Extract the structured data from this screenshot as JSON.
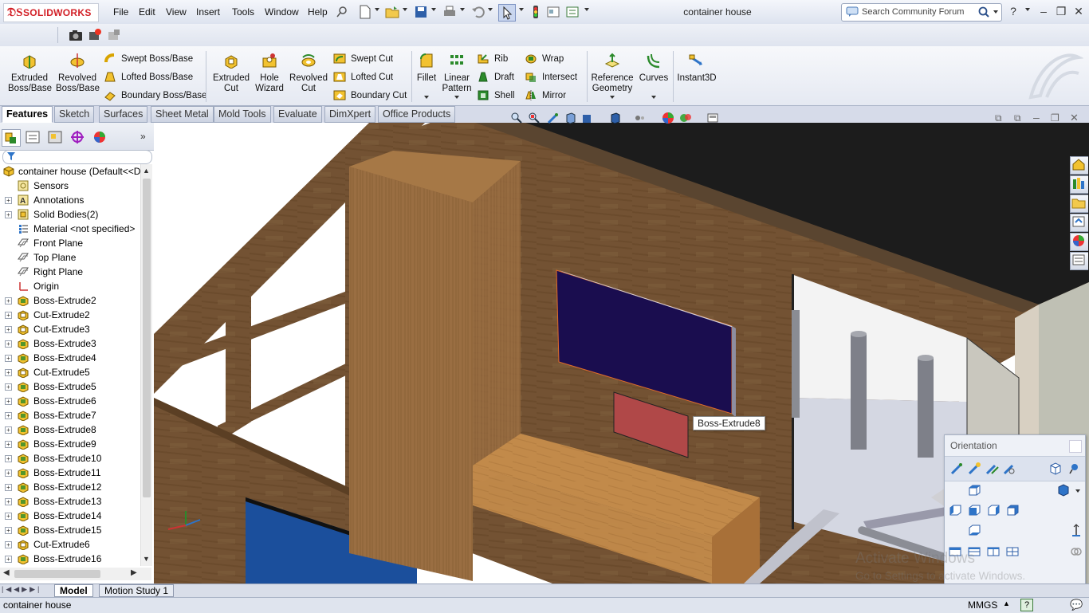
{
  "app": {
    "logo_text": "SOLIDWORKS",
    "document_title": "container house"
  },
  "menu": [
    "File",
    "Edit",
    "View",
    "Insert",
    "Tools",
    "Window",
    "Help"
  ],
  "search": {
    "placeholder": "Search Community Forum"
  },
  "window_controls": {
    "help": "?",
    "minimize": "–",
    "restore": "❐",
    "close": "✕"
  },
  "command_manager": {
    "extruded_boss": "Extruded Boss/Base",
    "revolved_boss": "Revolved Boss/Base",
    "swept_boss": "Swept Boss/Base",
    "lofted_boss": "Lofted Boss/Base",
    "boundary_boss": "Boundary Boss/Base",
    "extruded_cut": "Extruded Cut",
    "hole_wizard": "Hole Wizard",
    "revolved_cut": "Revolved Cut",
    "swept_cut": "Swept Cut",
    "lofted_cut": "Lofted Cut",
    "boundary_cut": "Boundary Cut",
    "fillet": "Fillet",
    "linear_pattern": "Linear Pattern",
    "rib": "Rib",
    "draft": "Draft",
    "shell": "Shell",
    "wrap": "Wrap",
    "intersect": "Intersect",
    "mirror": "Mirror",
    "reference_geometry": "Reference Geometry",
    "curves": "Curves",
    "instant3d": "Instant3D"
  },
  "tabs": [
    "Features",
    "Sketch",
    "Surfaces",
    "Sheet Metal",
    "Mold Tools",
    "Evaluate",
    "DimXpert",
    "Office Products"
  ],
  "active_tab": "Features",
  "feature_tree": {
    "root": "container house  (Default<<D",
    "items": [
      {
        "label": "Sensors",
        "icon": "sensor-icon",
        "expand": false
      },
      {
        "label": "Annotations",
        "icon": "annotations-icon",
        "expand": true
      },
      {
        "label": "Solid Bodies(2)",
        "icon": "solid-bodies-icon",
        "expand": true
      },
      {
        "label": "Material <not specified>",
        "icon": "material-icon",
        "expand": false
      },
      {
        "label": "Front Plane",
        "icon": "plane-icon",
        "expand": false
      },
      {
        "label": "Top Plane",
        "icon": "plane-icon",
        "expand": false
      },
      {
        "label": "Right Plane",
        "icon": "plane-icon",
        "expand": false
      },
      {
        "label": "Origin",
        "icon": "origin-icon",
        "expand": false
      },
      {
        "label": "Boss-Extrude2",
        "icon": "boss-extrude-icon",
        "expand": true
      },
      {
        "label": "Cut-Extrude2",
        "icon": "cut-extrude-icon",
        "expand": true
      },
      {
        "label": "Cut-Extrude3",
        "icon": "cut-extrude-icon",
        "expand": true
      },
      {
        "label": "Boss-Extrude3",
        "icon": "boss-extrude-icon",
        "expand": true
      },
      {
        "label": "Boss-Extrude4",
        "icon": "boss-extrude-icon",
        "expand": true
      },
      {
        "label": "Cut-Extrude5",
        "icon": "cut-extrude-icon",
        "expand": true
      },
      {
        "label": "Boss-Extrude5",
        "icon": "boss-extrude-icon",
        "expand": true
      },
      {
        "label": "Boss-Extrude6",
        "icon": "boss-extrude-icon",
        "expand": true
      },
      {
        "label": "Boss-Extrude7",
        "icon": "boss-extrude-icon",
        "expand": true
      },
      {
        "label": "Boss-Extrude8",
        "icon": "boss-extrude-icon",
        "expand": true
      },
      {
        "label": "Boss-Extrude9",
        "icon": "boss-extrude-icon",
        "expand": true
      },
      {
        "label": "Boss-Extrude10",
        "icon": "boss-extrude-icon",
        "expand": true
      },
      {
        "label": "Boss-Extrude11",
        "icon": "boss-extrude-icon",
        "expand": true
      },
      {
        "label": "Boss-Extrude12",
        "icon": "boss-extrude-icon",
        "expand": true
      },
      {
        "label": "Boss-Extrude13",
        "icon": "boss-extrude-icon",
        "expand": true
      },
      {
        "label": "Boss-Extrude14",
        "icon": "boss-extrude-icon",
        "expand": true
      },
      {
        "label": "Boss-Extrude15",
        "icon": "boss-extrude-icon",
        "expand": true
      },
      {
        "label": "Cut-Extrude6",
        "icon": "cut-extrude-icon",
        "expand": true
      },
      {
        "label": "Boss-Extrude16",
        "icon": "boss-extrude-icon",
        "expand": true
      }
    ]
  },
  "bottom_tabs": [
    "Model",
    "Motion Study 1"
  ],
  "status": {
    "left": "container house",
    "units": "MMGS"
  },
  "tooltip": "Boss-Extrude8",
  "orientation_panel": {
    "title": "Orientation"
  },
  "watermark": {
    "line1": "Activate Windows",
    "line2": "Go to Settings to activate Windows."
  },
  "colors": {
    "accent": "#d21f26",
    "wood": "#8b6440",
    "screen": "#1a0d4f",
    "rug": "#1b4f9c"
  }
}
